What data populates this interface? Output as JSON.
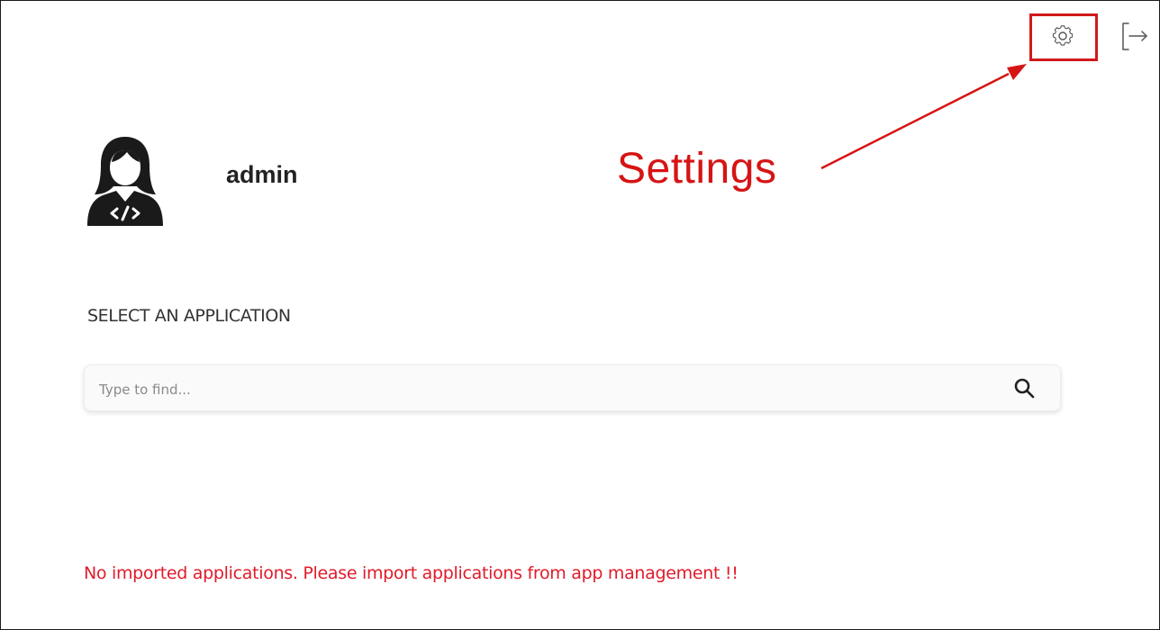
{
  "header": {
    "settings_icon": "gear-icon",
    "logout_icon": "logout-icon"
  },
  "annotation": {
    "label": "Settings",
    "color": "#d61414"
  },
  "user": {
    "name": "admin",
    "avatar_icon": "developer-avatar-icon"
  },
  "apps": {
    "section_title": "SELECT AN APPLICATION",
    "search": {
      "placeholder": "Type to find...",
      "value": "",
      "icon": "search-icon"
    },
    "empty_message": "No imported applications. Please import applications from app management !!",
    "message_color": "#e01b2a"
  }
}
